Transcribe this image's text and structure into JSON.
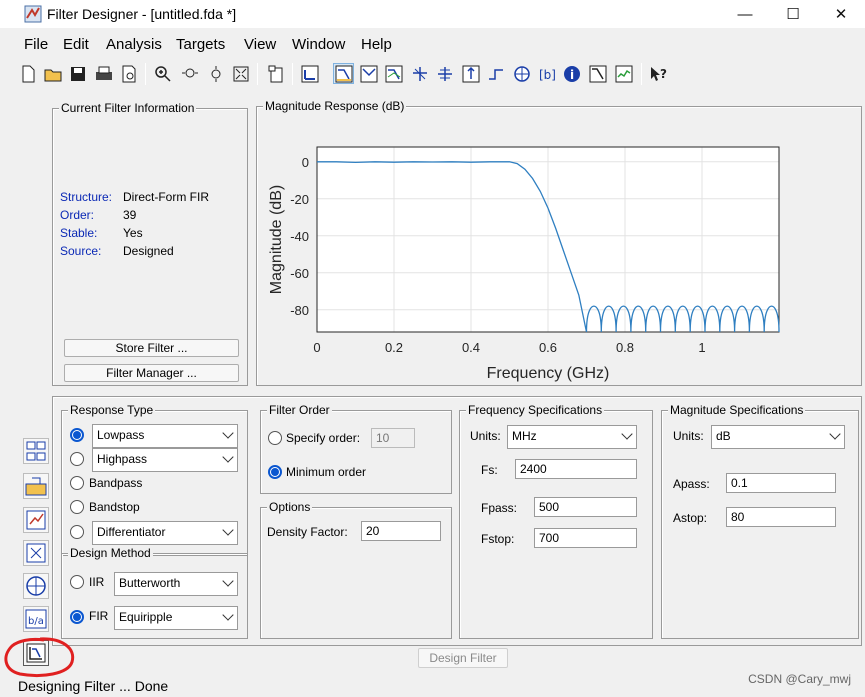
{
  "window": {
    "title": "Filter Designer - [untitled.fda *]",
    "minimize": "—",
    "maximize": "☐",
    "close": "✕"
  },
  "menus": [
    "File",
    "Edit",
    "Analysis",
    "Targets",
    "View",
    "Window",
    "Help"
  ],
  "toolbar_icons": [
    "new-file-icon",
    "open-folder-icon",
    "save-icon",
    "print-icon",
    "print-preview-icon",
    "zoom-in-icon",
    "zoom-x-icon",
    "zoom-y-icon",
    "full-view-icon",
    "new-figure-icon",
    "full-view-analysis-icon",
    "magnitude-response-icon",
    "phase-response-icon",
    "magnitude-phase-icon",
    "group-delay-icon",
    "phase-delay-icon",
    "impulse-response-icon",
    "step-response-icon",
    "pole-zero-icon",
    "filter-coefficients-icon",
    "filter-information-icon",
    "magnitude-estimate-icon",
    "round-off-noise-icon",
    "whats-this-icon"
  ],
  "current_filter": {
    "legend": "Current Filter Information",
    "rows": [
      {
        "key": "Structure:",
        "value": "Direct-Form FIR"
      },
      {
        "key": "Order:",
        "value": "39"
      },
      {
        "key": "Stable:",
        "value": "Yes"
      },
      {
        "key": "Source:",
        "value": "Designed"
      }
    ],
    "store_filter": "Store Filter ...",
    "filter_manager": "Filter Manager ..."
  },
  "magnitude_panel": {
    "legend": "Magnitude Response (dB)"
  },
  "chart_data": {
    "type": "line",
    "xlabel": "Frequency (GHz)",
    "ylabel": "Magnitude (dB)",
    "xlim": [
      0,
      1.2
    ],
    "ylim": [
      -92,
      8
    ],
    "xticks": [
      "0",
      "0.2",
      "0.4",
      "0.6",
      "0.8",
      "1"
    ],
    "yticks": [
      "0",
      "-20",
      "-40",
      "-60",
      "-80"
    ],
    "grid": true,
    "series": [
      {
        "color": "#2f7fc1",
        "x": [
          0,
          0.05,
          0.1,
          0.15,
          0.2,
          0.25,
          0.3,
          0.35,
          0.4,
          0.45,
          0.5,
          0.52,
          0.54,
          0.56,
          0.58,
          0.6,
          0.62,
          0.64,
          0.66,
          0.68,
          0.7
        ],
        "y": [
          0,
          0,
          -0.3,
          0,
          -0.2,
          0,
          -0.1,
          0,
          -0.2,
          0,
          0,
          -1,
          -4,
          -9,
          -16,
          -25,
          -36,
          -48,
          -60,
          -72,
          -92
        ]
      }
    ],
    "stopband_lobes": {
      "start": 0.7,
      "end": 1.2,
      "count": 13,
      "peak": -78,
      "floor": -92
    }
  },
  "response_type": {
    "legend": "Response Type",
    "lowpass": "Lowpass",
    "highpass": "Highpass",
    "bandpass": "Bandpass",
    "bandstop": "Bandstop",
    "differentiator": "Differentiator"
  },
  "design_method": {
    "legend": "Design Method",
    "iir_label": "IIR",
    "iir_value": "Butterworth",
    "fir_label": "FIR",
    "fir_value": "Equiripple"
  },
  "filter_order": {
    "legend": "Filter Order",
    "specify": "Specify order:",
    "specify_value": "10",
    "minimum": "Minimum order"
  },
  "options": {
    "legend": "Options",
    "density_label": "Density Factor:",
    "density_value": "20"
  },
  "freq_spec": {
    "legend": "Frequency Specifications",
    "units_label": "Units:",
    "units_value": "MHz",
    "fs_label": "Fs:",
    "fs_value": "2400",
    "fpass_label": "Fpass:",
    "fpass_value": "500",
    "fstop_label": "Fstop:",
    "fstop_value": "700"
  },
  "mag_spec": {
    "legend": "Magnitude Specifications",
    "units_label": "Units:",
    "units_value": "dB",
    "apass_label": "Apass:",
    "apass_value": "0.1",
    "astop_label": "Astop:",
    "astop_value": "80"
  },
  "design_filter": "Design Filter",
  "status": "Designing Filter ... Done",
  "watermark": "CSDN @Cary_mwj",
  "side_icons": [
    "transform-filter-icon",
    "import-filter-icon",
    "realize-model-icon",
    "pole-zero-editor-icon",
    "multirate-icon",
    "quantization-icon",
    "design-filter-icon"
  ]
}
